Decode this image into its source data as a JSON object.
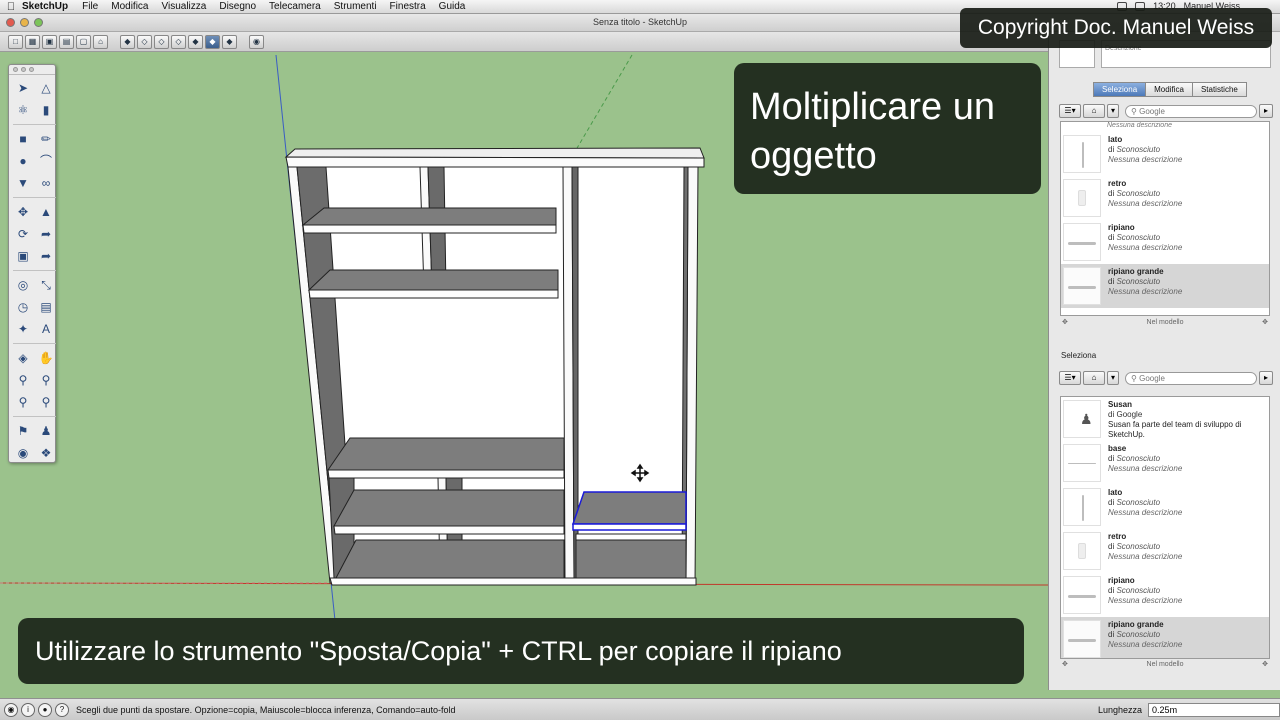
{
  "menubar": {
    "app": "SketchUp",
    "items": [
      "File",
      "Modifica",
      "Visualizza",
      "Disegno",
      "Telecamera",
      "Strumenti",
      "Finestra",
      "Guida"
    ],
    "clock": "13:20",
    "user": "Manuel Weiss"
  },
  "window": {
    "title": "Senza titolo - SketchUp"
  },
  "overlays": {
    "copyright": "Copyright Doc. Manuel Weiss",
    "headline": "Moltiplicare un oggetto",
    "caption": "Utilizzare lo strumento \"Sposta/Copia\" + CTRL per copiare il ripiano"
  },
  "right_panel": {
    "description_placeholder": "Descrizione",
    "tabs": [
      "Seleziona",
      "Modifica",
      "Statistiche"
    ],
    "search_placeholder": "Google",
    "top_list": {
      "partial_desc": "Nessuna descrizione",
      "items": [
        {
          "name": "lato",
          "by_prefix": "di",
          "by": "Sconosciuto",
          "desc": "Nessuna descrizione"
        },
        {
          "name": "retro",
          "by_prefix": "di",
          "by": "Sconosciuto",
          "desc": "Nessuna descrizione"
        },
        {
          "name": "ripiano",
          "by_prefix": "di",
          "by": "Sconosciuto",
          "desc": "Nessuna descrizione"
        },
        {
          "name": "ripiano grande",
          "by_prefix": "di",
          "by": "Sconosciuto",
          "desc": "Nessuna descrizione"
        }
      ],
      "footer": "Nel modello"
    },
    "section_label": "Seleziona",
    "bottom_list": {
      "items": [
        {
          "name": "Susan",
          "by_prefix": "di",
          "by": "Google",
          "desc": "Susan fa parte del team di sviluppo di SketchUp."
        },
        {
          "name": "base",
          "by_prefix": "di",
          "by": "Sconosciuto",
          "desc": "Nessuna descrizione"
        },
        {
          "name": "lato",
          "by_prefix": "di",
          "by": "Sconosciuto",
          "desc": "Nessuna descrizione"
        },
        {
          "name": "retro",
          "by_prefix": "di",
          "by": "Sconosciuto",
          "desc": "Nessuna descrizione"
        },
        {
          "name": "ripiano",
          "by_prefix": "di",
          "by": "Sconosciuto",
          "desc": "Nessuna descrizione"
        },
        {
          "name": "ripiano grande",
          "by_prefix": "di",
          "by": "Sconosciuto",
          "desc": "Nessuna descrizione"
        }
      ],
      "footer": "Nel modello"
    }
  },
  "statusbar": {
    "hint": "Scegli due punti da spostare.  Opzione=copia, Maiuscole=blocca inferenza, Comando=auto-fold",
    "measure_label": "Lunghezza",
    "measure_value": "0.25m"
  },
  "colors": {
    "background": "#9bc28c",
    "overlay": "#243021",
    "selection": "#1a1ad8",
    "axis_red": "#c0392b",
    "axis_green": "#3a8a3a",
    "axis_blue": "#3a5cc4"
  }
}
